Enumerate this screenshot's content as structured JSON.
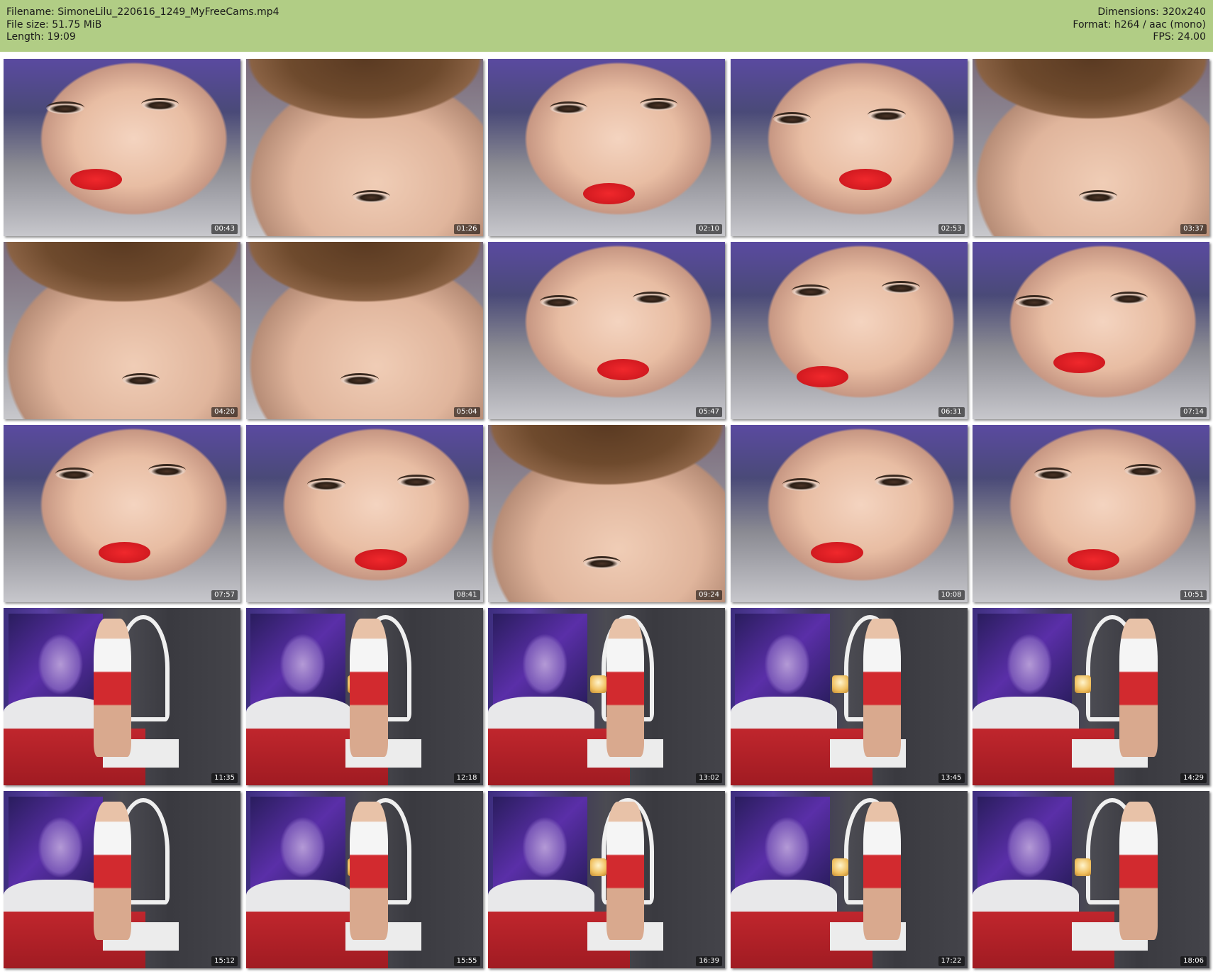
{
  "header": {
    "filename": "Filename: SimoneLilu_220616_1249_MyFreeCams.mp4",
    "filesize": "File size: 51.75 MiB",
    "length": "Length: 19:09",
    "dimensions": "Dimensions: 320x240",
    "format": "Format: h264 / aac (mono)",
    "fps": "FPS: 24.00"
  },
  "colors": {
    "header_bg": "#b1cd85",
    "page_bg": "#ffffff"
  },
  "thumbnails": [
    {
      "time": "00:43",
      "scene": "face"
    },
    {
      "time": "01:26",
      "scene": "hair"
    },
    {
      "time": "02:10",
      "scene": "face"
    },
    {
      "time": "02:53",
      "scene": "face"
    },
    {
      "time": "03:37",
      "scene": "hair"
    },
    {
      "time": "04:20",
      "scene": "hair"
    },
    {
      "time": "05:04",
      "scene": "hair"
    },
    {
      "time": "05:47",
      "scene": "face"
    },
    {
      "time": "06:31",
      "scene": "face"
    },
    {
      "time": "07:14",
      "scene": "face"
    },
    {
      "time": "07:57",
      "scene": "face"
    },
    {
      "time": "08:41",
      "scene": "face"
    },
    {
      "time": "09:24",
      "scene": "hair"
    },
    {
      "time": "10:08",
      "scene": "face"
    },
    {
      "time": "10:51",
      "scene": "face"
    },
    {
      "time": "11:35",
      "scene": "room"
    },
    {
      "time": "12:18",
      "scene": "room"
    },
    {
      "time": "13:02",
      "scene": "room"
    },
    {
      "time": "13:45",
      "scene": "room"
    },
    {
      "time": "14:29",
      "scene": "room"
    },
    {
      "time": "15:12",
      "scene": "room"
    },
    {
      "time": "15:55",
      "scene": "room"
    },
    {
      "time": "16:39",
      "scene": "room"
    },
    {
      "time": "17:22",
      "scene": "room"
    },
    {
      "time": "18:06",
      "scene": "room"
    }
  ]
}
